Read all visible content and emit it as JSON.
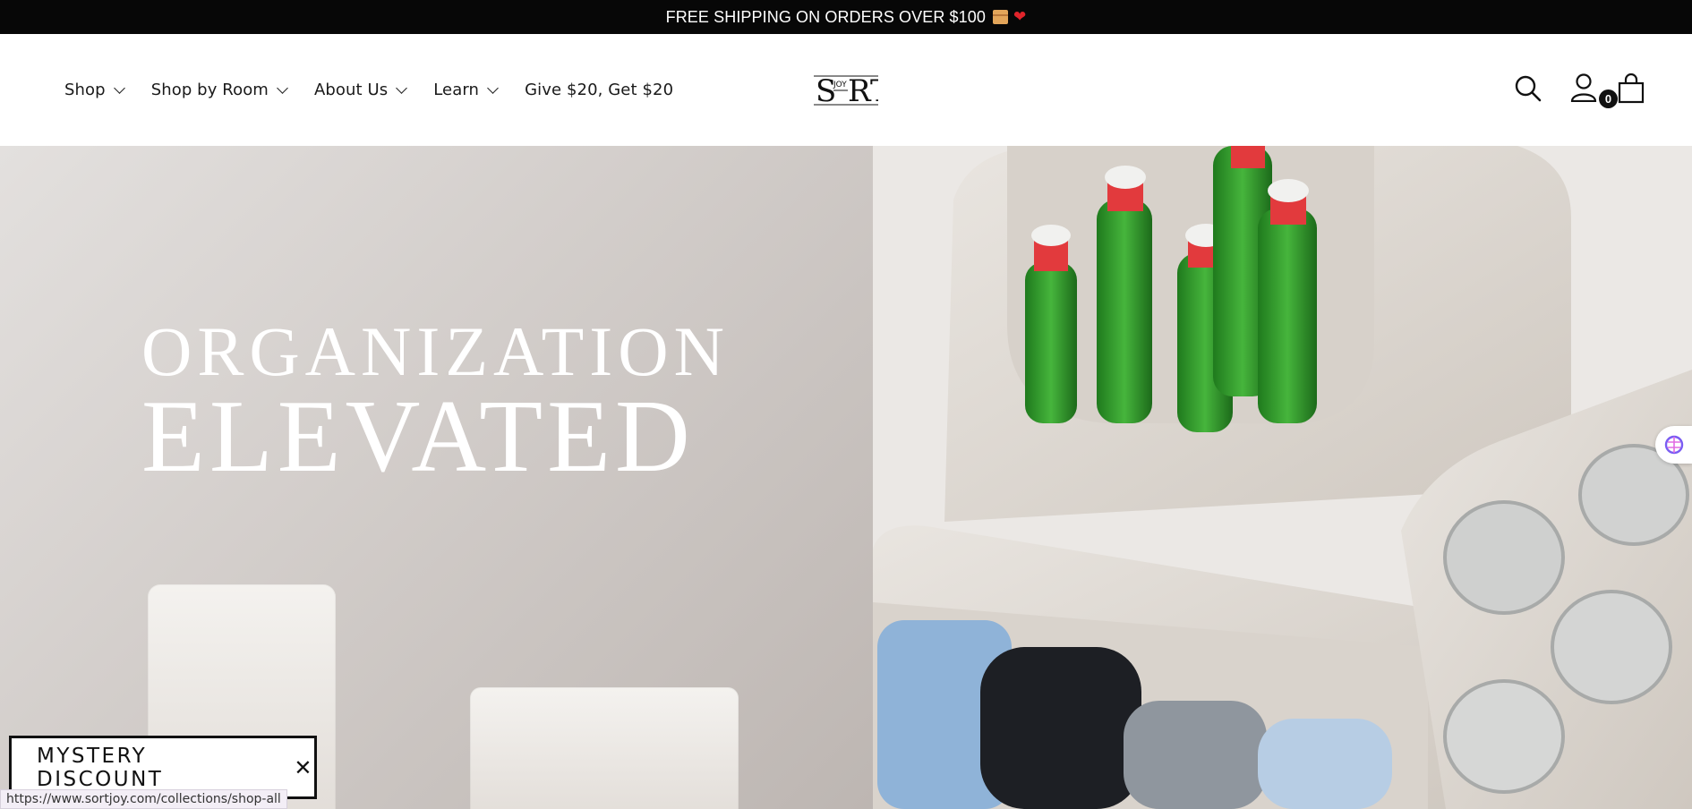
{
  "announcement": {
    "text": "FREE SHIPPING ON ORDERS OVER $100",
    "emoji_box": "package-icon",
    "emoji_heart": "heart-icon"
  },
  "nav": {
    "items": [
      {
        "label": "Shop",
        "has_dropdown": true
      },
      {
        "label": "Shop by Room",
        "has_dropdown": true
      },
      {
        "label": "About Us",
        "has_dropdown": true
      },
      {
        "label": "Learn",
        "has_dropdown": true
      },
      {
        "label": "Give $20, Get $20",
        "has_dropdown": false
      }
    ]
  },
  "logo": {
    "main": "SRT",
    "small": "JOY"
  },
  "header_icons": {
    "search": "search-icon",
    "account": "account-icon",
    "cart": "cart-icon",
    "cart_count": "0"
  },
  "hero": {
    "line1": "ORGANIZATION",
    "line2": "ELEVATED"
  },
  "mystery": {
    "label": "MYSTERY DISCOUNT",
    "close": "✕"
  },
  "status_url": "https://www.sortjoy.com/collections/shop-all",
  "colors": {
    "announce_bg": "#070707",
    "heart": "#e0242b",
    "bottle_green": "#2f9a2a",
    "bottle_cap": "#e23a3d"
  }
}
